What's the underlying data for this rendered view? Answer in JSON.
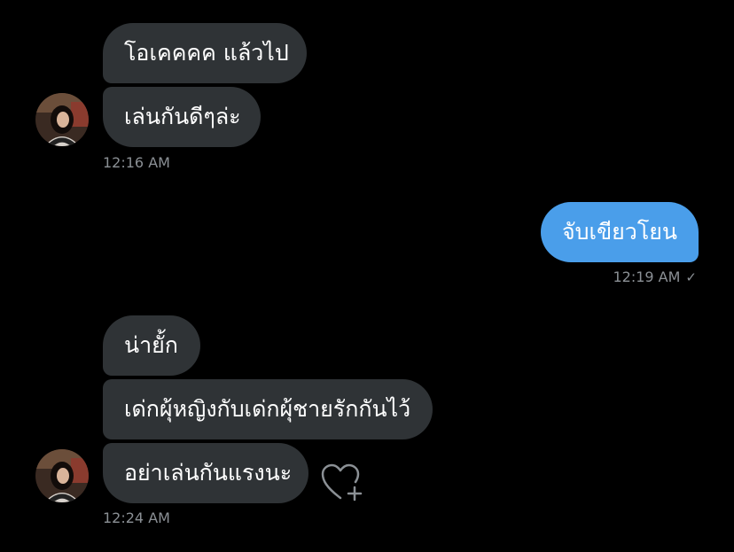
{
  "colors": {
    "background": "#000000",
    "received_bubble": "#2f3336",
    "sent_bubble": "#4a9eea",
    "timestamp": "#8b9095"
  },
  "messages": {
    "group1": {
      "bubbles": [
        "โอเคคคค แล้วไป",
        "เล่นกันดีๆล่ะ"
      ],
      "time": "12:16 AM"
    },
    "group2": {
      "bubbles": [
        "จับเขียวโยน"
      ],
      "time": "12:19 AM",
      "status_icon": "check-icon"
    },
    "group3": {
      "bubbles": [
        "น่ายั้ก",
        "เด่กผุ้หญิงกับเด่กผุ้ชายรักกันไว้",
        "อย่าเล่นกันแรงนะ"
      ],
      "time": "12:24 AM",
      "reaction_icon": "heart-plus-icon"
    }
  }
}
